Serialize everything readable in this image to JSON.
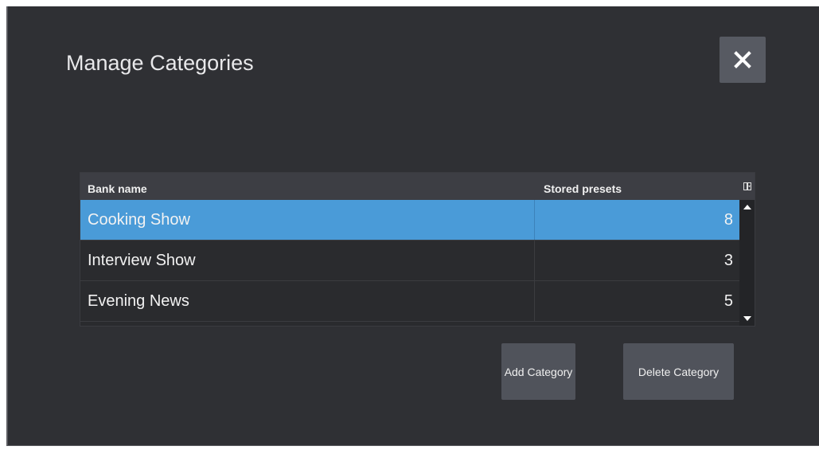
{
  "dialog": {
    "title": "Manage Categories",
    "close_icon": "close-icon"
  },
  "table": {
    "columns": [
      "Bank name",
      "Stored presets"
    ],
    "rows": [
      {
        "name": "Cooking Show",
        "presets": "8",
        "selected": true
      },
      {
        "name": "Interview Show",
        "presets": "3",
        "selected": false
      },
      {
        "name": "Evening News",
        "presets": "5",
        "selected": false
      }
    ],
    "column_menu_icon": "column-chooser-icon",
    "scroll_up_icon": "scroll-up-arrow-icon",
    "scroll_down_icon": "scroll-down-arrow-icon"
  },
  "actions": {
    "add_label": "Add Category",
    "delete_label": "Delete Category"
  },
  "colors": {
    "background": "#2f3034",
    "header": "#3d3e44",
    "selected_row": "#4a9bd8",
    "button": "#50535b"
  }
}
